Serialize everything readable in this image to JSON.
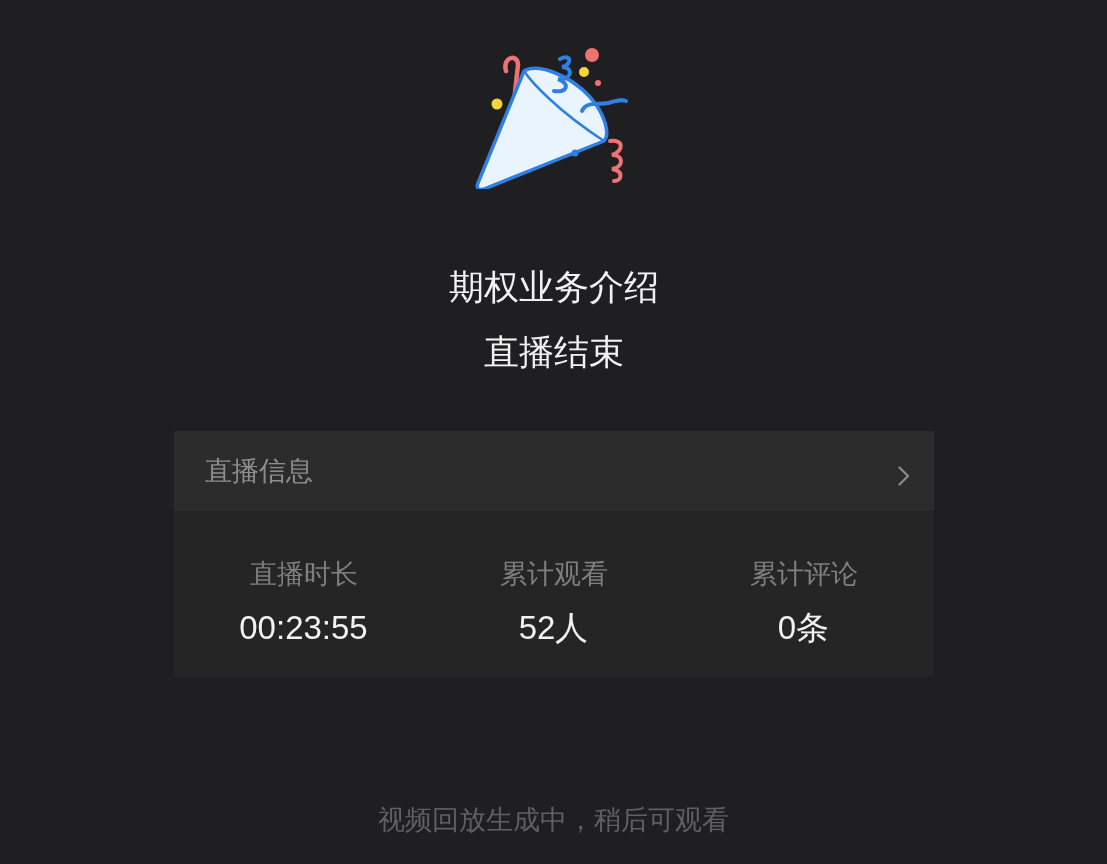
{
  "event": {
    "title": "期权业务介绍",
    "status": "直播结束"
  },
  "info_card": {
    "header": {
      "label": "直播信息"
    },
    "stats": [
      {
        "label": "直播时长",
        "value": "00:23:55"
      },
      {
        "label": "累计观看",
        "value": "52人"
      },
      {
        "label": "累计评论",
        "value": "0条"
      }
    ]
  },
  "footer": {
    "note": "视频回放生成中，稍后可观看"
  }
}
